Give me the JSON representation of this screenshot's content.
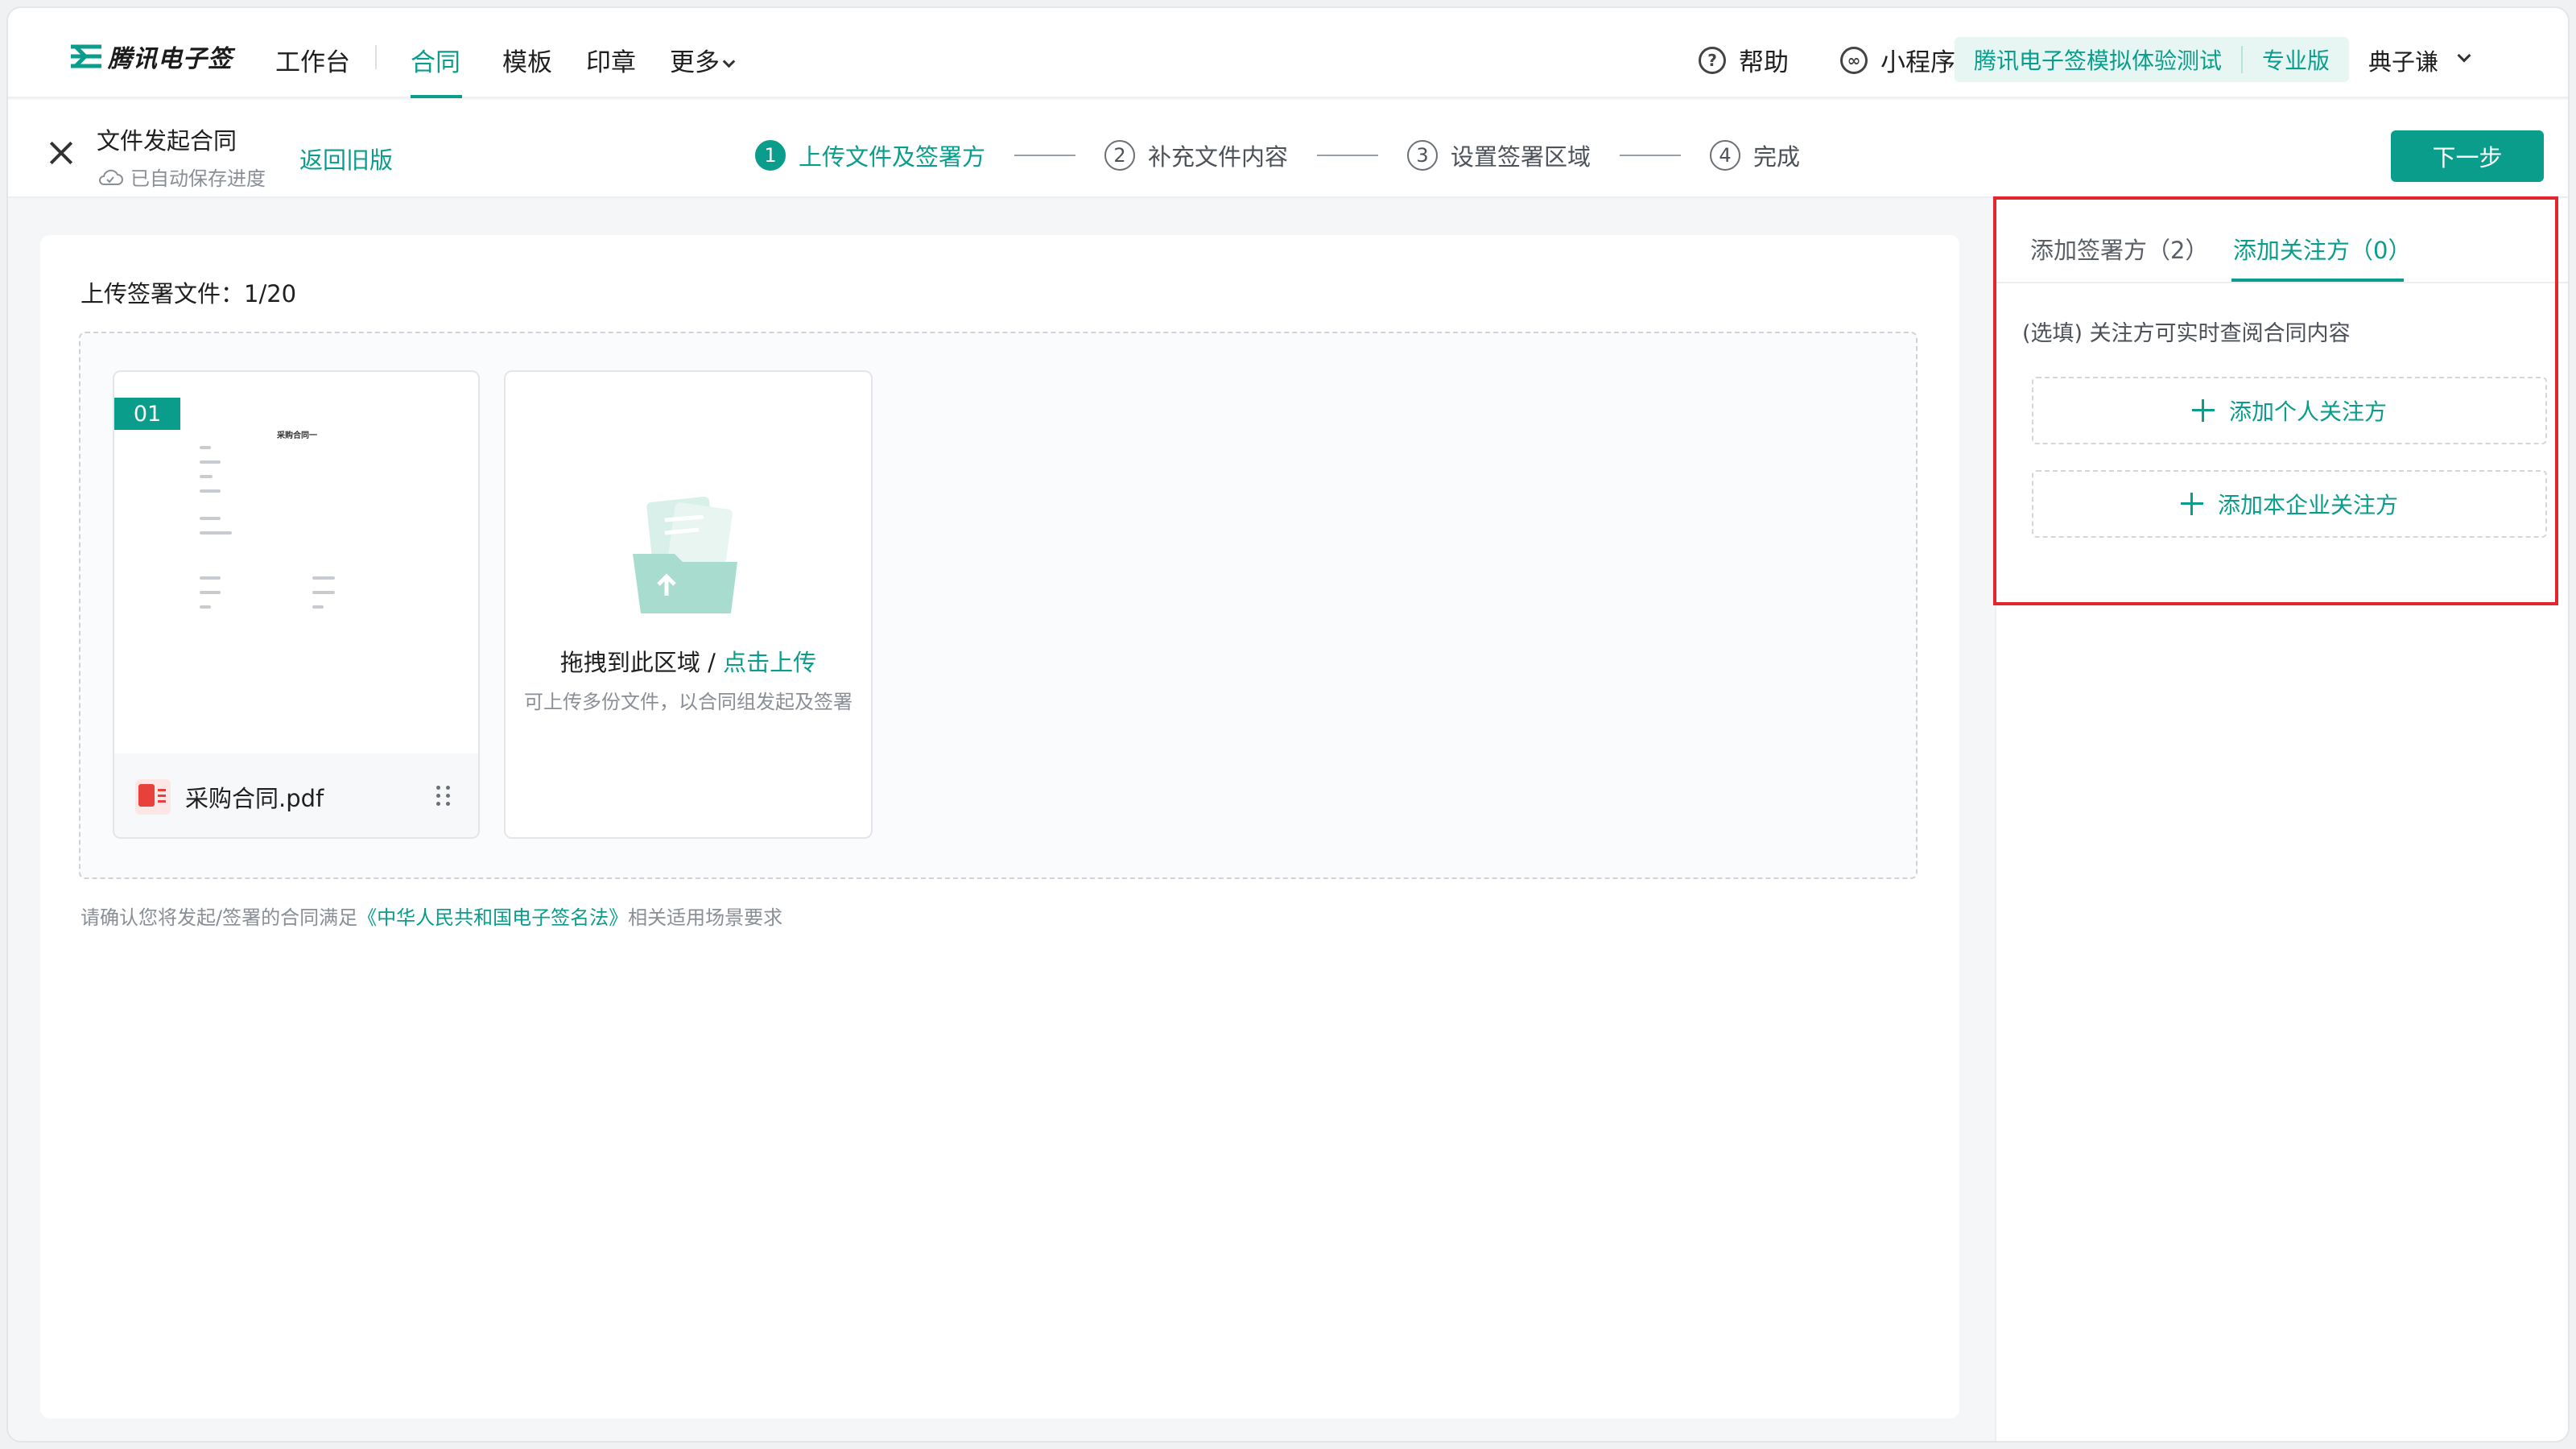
{
  "brand": {
    "name": "腾讯电子签",
    "color": "#0a9d8b"
  },
  "nav": {
    "workbench": "工作台",
    "contract": "合同",
    "template": "模板",
    "seal": "印章",
    "more": "更多"
  },
  "nav_right": {
    "help": "帮助",
    "miniprogram": "小程序",
    "org": "腾讯电子签模拟体验测试",
    "plan": "专业版",
    "user": "典子谦"
  },
  "subbar": {
    "title": "文件发起合同",
    "autosave": "已自动保存进度",
    "back_old": "返回旧版",
    "next": "下一步"
  },
  "steps": [
    {
      "num": "1",
      "label": "上传文件及签署方"
    },
    {
      "num": "2",
      "label": "补充文件内容"
    },
    {
      "num": "3",
      "label": "设置签署区域"
    },
    {
      "num": "4",
      "label": "完成"
    }
  ],
  "upload": {
    "title": "上传签署文件：1/20",
    "file": {
      "badge": "01",
      "name": "采购合同.pdf",
      "preview_heading": "采购合同一"
    },
    "drag_text": "拖拽到此区域 / ",
    "drag_link": "点击上传",
    "drag_hint": "可上传多份文件，以合同组发起及签署",
    "law_prefix": "请确认您将发起/签署的合同满足",
    "law_link": "《中华人民共和国电子签名法》",
    "law_suffix": "相关适用场景要求"
  },
  "panel": {
    "tab_signers": "添加签署方（2）",
    "tab_watchers": "添加关注方（0）",
    "desc": "(选填) 关注方可实时查阅合同内容",
    "add_person": "添加个人关注方",
    "add_company": "添加本企业关注方"
  }
}
